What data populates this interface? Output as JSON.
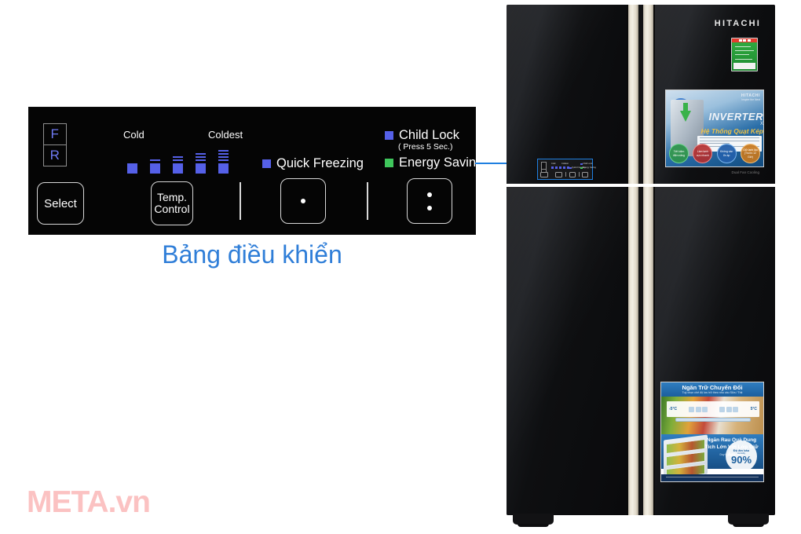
{
  "caption": "Bảng điều khiển",
  "watermark": {
    "meta": "META",
    "vn": ".vn"
  },
  "colors": {
    "indicator_blue": "#5560e8",
    "indicator_green": "#3fc65c",
    "caption_blue": "#2f7ed8",
    "panel_black": "#050505",
    "highlight_blue": "#1f7fe0",
    "watermark_pink": "#fbc2c2",
    "handle_cream": "#f3efe4"
  },
  "panel": {
    "mode_selector": {
      "labels": [
        "F",
        "R"
      ]
    },
    "temperature": {
      "min_label": "Cold",
      "max_label": "Coldest",
      "steps": 5,
      "bars_per_step": [
        0,
        1,
        2,
        3,
        4
      ]
    },
    "features": [
      {
        "name": "quick-freezing",
        "label": "Quick Freezing",
        "led": "blue",
        "sub": ""
      },
      {
        "name": "child-lock",
        "label": "Child Lock",
        "led": "blue",
        "sub": "( Press 5 Sec.)"
      },
      {
        "name": "energy-saving",
        "label": "Energy Saving",
        "led": "green",
        "sub": ""
      }
    ],
    "buttons": {
      "select": "Select",
      "temp_line1": "Temp.",
      "temp_line2": "Control",
      "quick_freezing_glyph": "•",
      "energy_saving_glyph": "⋮"
    }
  },
  "fridge": {
    "brand": "HITACHI",
    "model_text": "Dual Fan Cooling",
    "energy_label": {
      "name": "energy-rating-label"
    },
    "stickers": {
      "inverter": {
        "brand": "HITACHI",
        "brand_sub": "Inspire the Next",
        "title": "INVERTER",
        "cross": "X",
        "subtitle": "Hệ Thống Quạt Kép",
        "circles": [
          "Tiết kiệm điện năng",
          "Làm lạnh cực nhanh",
          "Không cần ổn áp",
          "Giữ lạnh lâu (Trước 12 Giờ)"
        ]
      },
      "fresh": {
        "title1": "Ngăn Trữ Chuyển Đổi",
        "sub1": "Tuỳ chọn chế độ lưu trữ theo nhu cầu Sữa / Thịt",
        "temp_left": "-5°C",
        "temp_right": "5°C",
        "title2": "Ngăn Rau Quả Dung Tích Lớn Với Lớp Giữ Ẩm",
        "sub2": "Duy trì độ ẩm tối ưu",
        "badge_top": "Độ ẩm bảo",
        "badge_sub": "Humidity",
        "badge_value": "90%"
      }
    },
    "door_panel_highlight": {
      "name": "control-panel-highlight",
      "cold": "Cold",
      "coldest": "Coldest",
      "quick": "Quick Freezing",
      "child": "Child Lock",
      "energy": "Energy Saving",
      "fr": [
        "F",
        "R"
      ]
    }
  }
}
